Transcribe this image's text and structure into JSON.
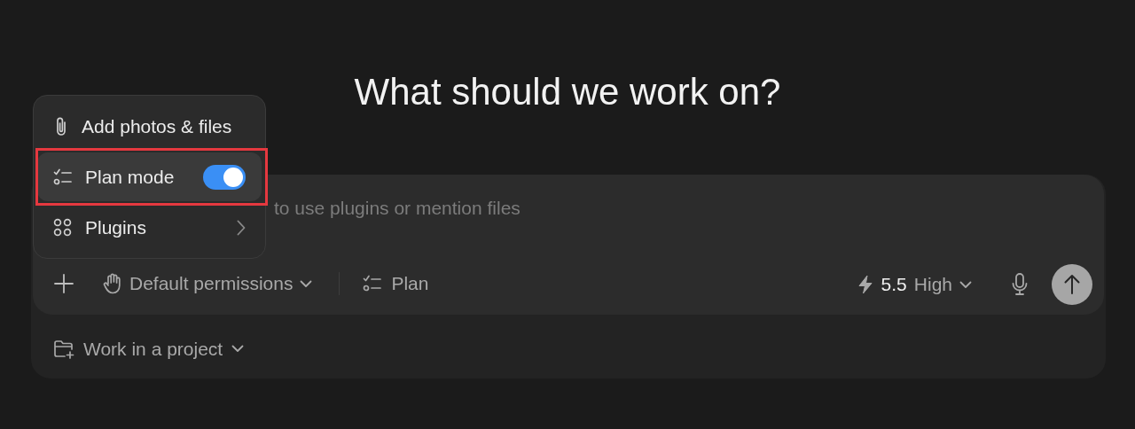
{
  "heading": "What should we work on?",
  "composer": {
    "placeholder": "to use plugins or mention files",
    "permissions": "Default permissions",
    "mode": "Plan",
    "model": "5.5",
    "effort": "High"
  },
  "menu": {
    "items": [
      {
        "kind": "action",
        "label": "Add photos & files",
        "highlighted": false
      },
      {
        "kind": "toggle",
        "label": "Plan mode",
        "on": true,
        "highlighted": true
      },
      {
        "kind": "submenu",
        "label": "Plugins",
        "highlighted": false
      }
    ]
  },
  "project": {
    "label": "Work in a project"
  }
}
